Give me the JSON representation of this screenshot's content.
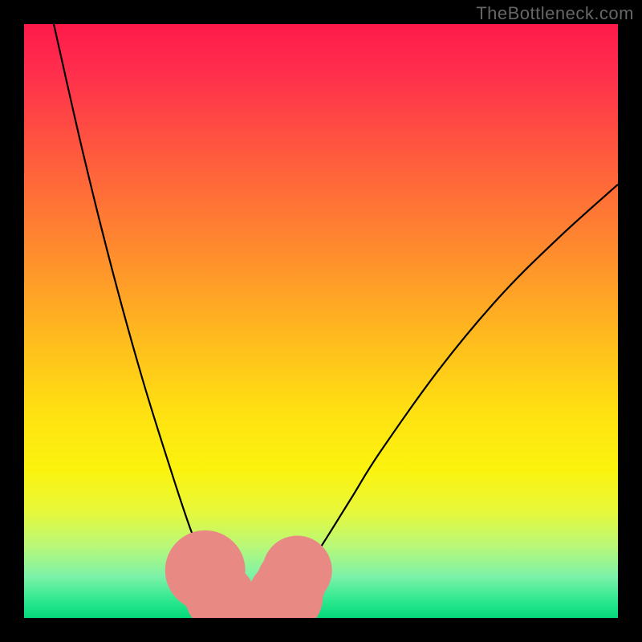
{
  "watermark": "TheBottleneck.com",
  "chart_data": {
    "type": "line",
    "title": "",
    "xlabel": "",
    "ylabel": "",
    "xlim": [
      0,
      100
    ],
    "ylim": [
      0,
      100
    ],
    "grid": false,
    "legend": false,
    "series": [
      {
        "name": "left-curve",
        "x": [
          5,
          10,
          15,
          20,
          25,
          28,
          30,
          32,
          34,
          36
        ],
        "y": [
          100,
          78,
          58,
          40,
          24,
          15,
          10,
          6,
          3,
          1
        ]
      },
      {
        "name": "right-curve",
        "x": [
          42,
          44,
          46,
          50,
          55,
          60,
          70,
          80,
          90,
          100
        ],
        "y": [
          1,
          3,
          6,
          12,
          20,
          28,
          42,
          54,
          64,
          73
        ]
      }
    ],
    "markers": [
      {
        "x": 30.5,
        "y": 8,
        "r": 1.5
      },
      {
        "x": 31.5,
        "y": 6,
        "r": 1.3
      },
      {
        "x": 33,
        "y": 3.5,
        "r": 1.3
      },
      {
        "x": 44,
        "y": 3.5,
        "r": 1.4
      },
      {
        "x": 45,
        "y": 6,
        "r": 1.3
      },
      {
        "x": 46,
        "y": 8,
        "r": 1.3
      }
    ],
    "sausage": {
      "path": [
        {
          "x": 34,
          "y": 2.5
        },
        {
          "x": 36,
          "y": 1
        },
        {
          "x": 40,
          "y": 0.8
        },
        {
          "x": 42,
          "y": 2
        }
      ]
    }
  }
}
